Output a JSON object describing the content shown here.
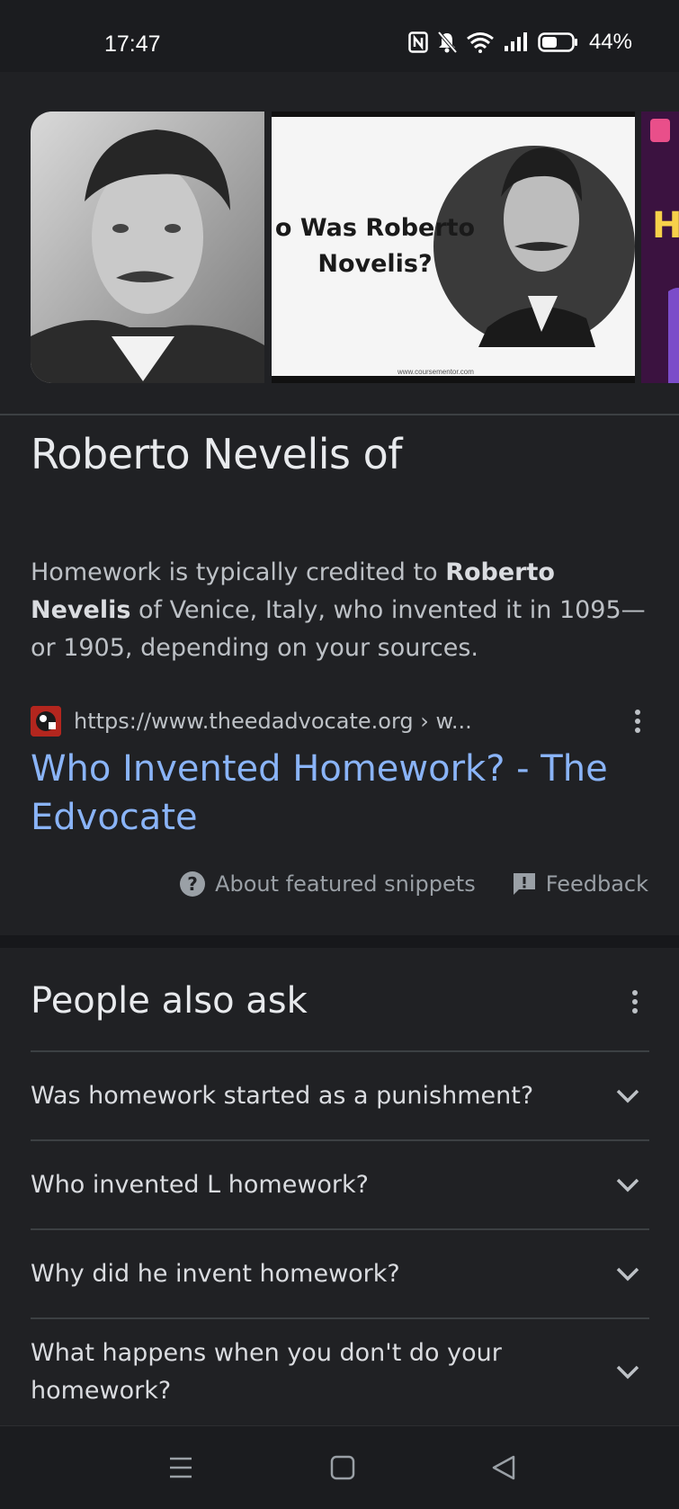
{
  "status": {
    "time": "17:47",
    "battery": "44%"
  },
  "images": [
    {
      "name": "portrait-photo"
    },
    {
      "name": "thumbnail-card",
      "caption": "o Was Roberto Novelis?",
      "site": "www.coursementor.com"
    },
    {
      "name": "thumbnail-partial"
    }
  ],
  "snippet": {
    "title": "Roberto Nevelis of",
    "text_before": "Homework is typically credited to ",
    "text_bold": "Roberto Nevelis",
    "text_after": " of Venice, Italy, who invented it in 1095—or 1905, depending on your sources.",
    "source_url": "https://www.theedadvocate.org › w...",
    "link_title": "Who Invented Homework? - The Edvocate",
    "about_label": "About featured snippets",
    "feedback_label": "Feedback"
  },
  "people_also_ask": {
    "title": "People also ask",
    "questions": [
      "Was homework started as a punishment?",
      "Who invented L homework?",
      "Why did he invent homework?",
      "What happens when you don't do your homework?"
    ]
  },
  "colors": {
    "background": "#202124",
    "link": "#8ab4f8",
    "divider": "#3c4043"
  }
}
